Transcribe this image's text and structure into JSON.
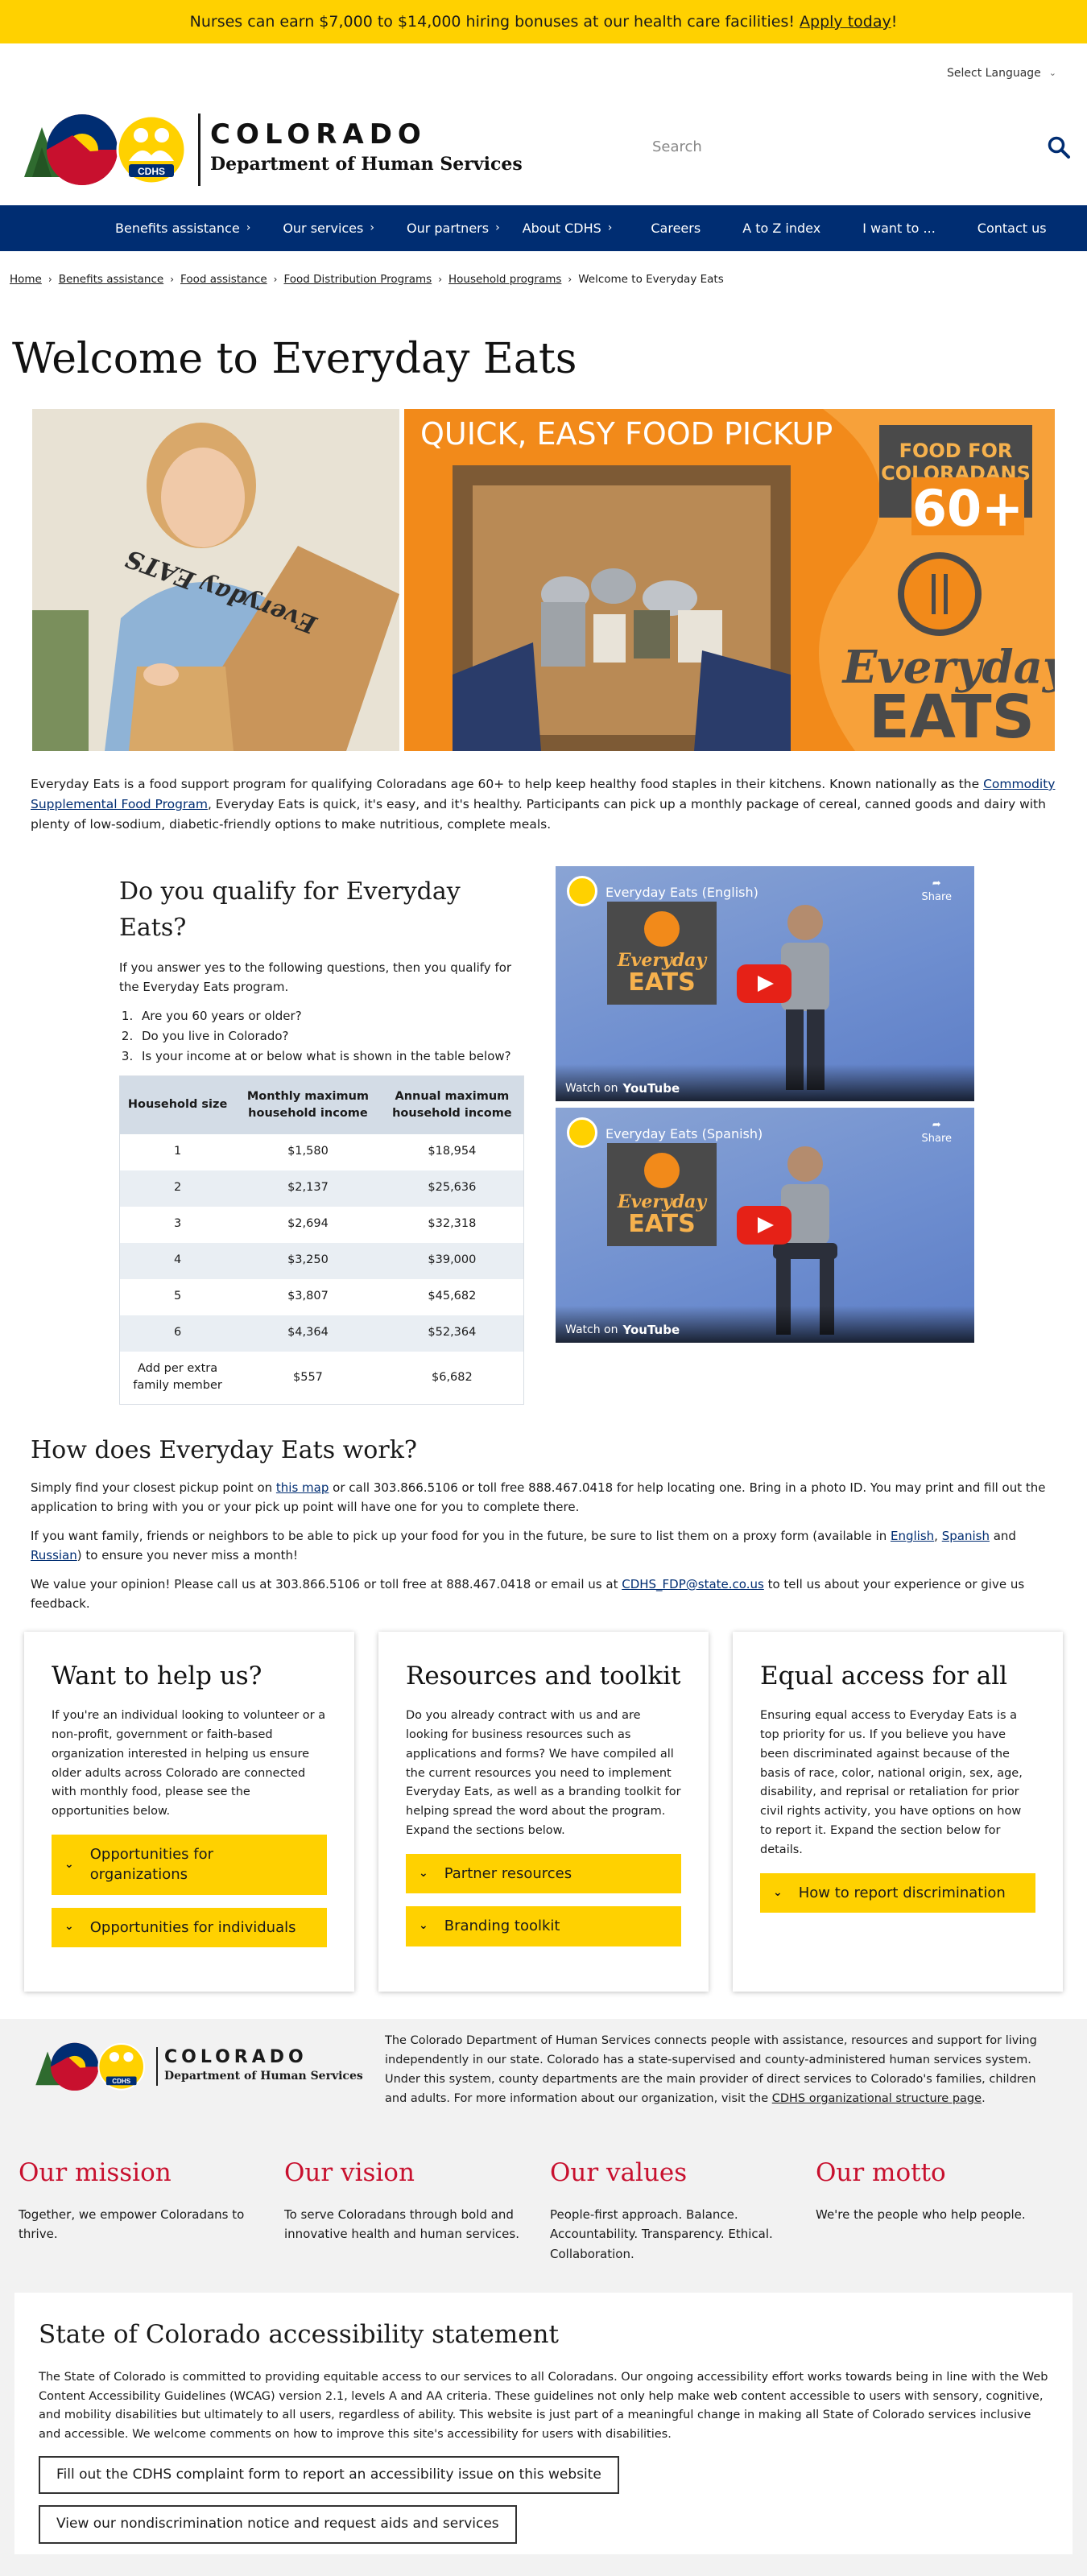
{
  "alert": {
    "text": "Nurses can earn $7,000 to $14,000 hiring bonuses at our health care facilities!",
    "link": "Apply today",
    "suffix": "!"
  },
  "language": {
    "label": "Select Language"
  },
  "header": {
    "brand": "COLORADO",
    "department": "Department of Human Services",
    "badge": "CDHS"
  },
  "search": {
    "placeholder": "Search"
  },
  "nav": {
    "items": [
      {
        "label": "Benefits assistance",
        "arrow": "›"
      },
      {
        "label": "Our services",
        "arrow": "›"
      },
      {
        "label": "Our partners",
        "arrow": "›"
      },
      {
        "label": "About CDHS",
        "arrow": "›"
      },
      {
        "label": "Careers",
        "arrow": ""
      },
      {
        "label": "A to Z index",
        "arrow": ""
      },
      {
        "label": "I want to ...",
        "arrow": ""
      },
      {
        "label": "Contact us",
        "arrow": ""
      }
    ]
  },
  "breadcrumb": {
    "items": [
      "Home",
      "Benefits assistance",
      "Food assistance",
      "Food Distribution Programs",
      "Household programs"
    ],
    "current": "Welcome to Everyday Eats"
  },
  "page_title": "Welcome to Everyday Eats",
  "hero": {
    "banner_heading": "QUICK, EASY FOOD PICKUP",
    "sign_line1": "FOOD FOR",
    "sign_line2": "COLORADANS",
    "sign_age": "60+",
    "brand_line1": "Everyday",
    "brand_line2": "EATS",
    "box_text": "Everyday EATS"
  },
  "intro": {
    "before": "Everyday Eats is a food support program for qualifying Coloradans age 60+ to help keep healthy food staples in their kitchens. Known nationally as the ",
    "link": "Commodity Supplemental Food Program",
    "after": ", Everyday Eats is quick, it's easy, and it's healthy. Participants can pick up a monthly package of cereal, canned goods and dairy with plenty of low-sodium, diabetic-friendly options to make nutritious, complete meals."
  },
  "qualify": {
    "heading": "Do you qualify for Everyday Eats?",
    "lead": "If you answer yes to the following questions, then you qualify for the Everyday Eats program.",
    "questions": [
      "Are you 60 years or older?",
      "Do you live in Colorado?",
      "Is your income at or below what is shown in the table below?"
    ],
    "table": {
      "headers": [
        "Household size",
        "Monthly maximum household income",
        "Annual maximum household income"
      ],
      "rows": [
        [
          "1",
          "$1,580",
          "$18,954"
        ],
        [
          "2",
          "$2,137",
          "$25,636"
        ],
        [
          "3",
          "$2,694",
          "$32,318"
        ],
        [
          "4",
          "$3,250",
          "$39,000"
        ],
        [
          "5",
          "$3,807",
          "$45,682"
        ],
        [
          "6",
          "$4,364",
          "$52,364"
        ],
        [
          "Add per extra family member",
          "$557",
          "$6,682"
        ]
      ]
    }
  },
  "videos": [
    {
      "title": "Everyday Eats (English)",
      "share": "Share",
      "watch": "Watch on",
      "yt": "YouTube",
      "logo_line1": "Everyday",
      "logo_line2": "EATS"
    },
    {
      "title": "Everyday Eats (Spanish)",
      "share": "Share",
      "watch": "Watch on",
      "yt": "YouTube",
      "logo_line1": "Everyday",
      "logo_line2": "EATS"
    }
  ],
  "how": {
    "heading": "How does Everyday Eats work?",
    "p1_before": "Simply find your closest pickup point on ",
    "p1_link": "this map",
    "p1_after": " or call 303.866.5106 or toll free 888.467.0418 for help locating one. Bring in a photo ID. You may print and fill out the application to bring with you or your pick up point will have one for you to complete there.",
    "p2_before": "If you want family, friends or neighbors to be able to pick up your food for you in the future, be sure to list them on a proxy form (available in ",
    "p2_link1": "English",
    "p2_sep1": ", ",
    "p2_link2": "Spanish",
    "p2_sep2": " and ",
    "p2_link3": "Russian",
    "p2_after": ") to ensure you never miss a month!",
    "p3_before": "We value your opinion! Please call us at 303.866.5106 or toll free at 888.467.0418 or email us at ",
    "p3_link": "CDHS_FDP@state.co.us",
    "p3_after": " to tell us about your experience or give us feedback."
  },
  "cards": [
    {
      "heading": "Want to help us?",
      "body": "If you're an individual looking to volunteer or a non-profit, government or faith-based organization interested in helping us ensure older adults across Colorado are connected with monthly food, please see the opportunities below.",
      "buttons": [
        "Opportunities for organizations",
        "Opportunities for individuals"
      ]
    },
    {
      "heading": "Resources and toolkit",
      "body": "Do you already contract with us and are looking for business resources such as applications and forms? We have compiled all the current resources you need to implement Everyday Eats, as well as a branding toolkit for helping spread the word about the program. Expand the sections below.",
      "buttons": [
        "Partner resources",
        "Branding toolkit"
      ]
    },
    {
      "heading": "Equal access for all",
      "body": "Ensuring equal access to Everyday Eats is a top priority for us. If you believe you have been discriminated against because of the basis of race, color, national origin, sex, age, disability, and reprisal or retaliation for prior civil rights activity, you have options on how to report it. Expand the section below for details.",
      "buttons": [
        "How to report discrimination"
      ]
    }
  ],
  "footer": {
    "brand": "COLORADO",
    "department": "Department of Human Services",
    "badge": "CDHS",
    "about_before": "The Colorado Department of Human Services connects people with assistance, resources and support for living independently in our state. Colorado has a state-supervised and county-administered human services system. Under this system, county departments are the main provider of direct services to Colorado's families, children and adults. For more information about our organization, visit the ",
    "about_link": "CDHS organizational structure page",
    "about_after": ".",
    "blocks": [
      {
        "heading": "Our mission",
        "text": "Together, we empower Coloradans to thrive."
      },
      {
        "heading": "Our vision",
        "text": "To serve Coloradans through bold and innovative health and human services."
      },
      {
        "heading": "Our values",
        "text": "People-first approach. Balance. Accountability. Transparency. Ethical. Collaboration."
      },
      {
        "heading": "Our motto",
        "text": "We're the people who help people."
      }
    ],
    "accessibility": {
      "heading": "State of Colorado accessibility statement",
      "text": "The State of Colorado is committed to providing equitable access to our services to all Coloradans. Our ongoing accessibility effort works towards being in line with the Web Content Accessibility Guidelines (WCAG) version 2.1, levels A and AA criteria. These guidelines not only help make web content accessible to users with sensory, cognitive, and mobility disabilities but ultimately to all users, regardless of ability. This website is just part of a meaningful change in making all State of Colorado services inclusive and accessible. We welcome comments on how to improve this site's accessibility for users with disabilities.",
      "button1": "Fill out the CDHS complaint form to report an accessibility issue on this website",
      "button2": "View our nondiscrimination notice and request aids and services"
    }
  },
  "colors": {
    "alert": "#ffd100",
    "nav": "#002d72",
    "accent_red": "#c8102e",
    "accordion": "#ffd100",
    "hero_orange": "#f28a1a"
  }
}
